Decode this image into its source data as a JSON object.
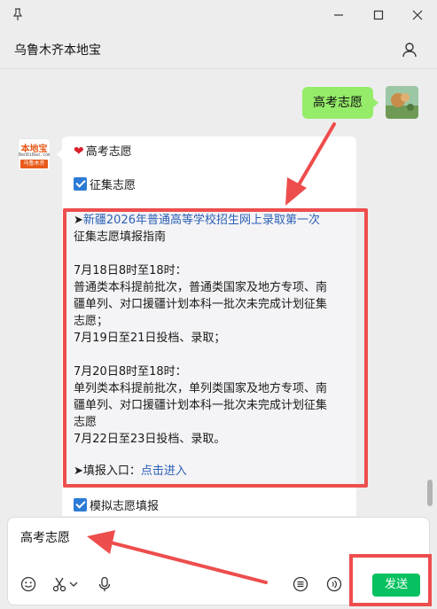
{
  "window": {
    "pin_icon": "pin-icon",
    "minimize_icon": "minimize-icon",
    "maximize_icon": "maximize-icon",
    "close_icon": "close-icon"
  },
  "header": {
    "title": "乌鲁木齐本地宝",
    "profile_icon": "user-icon"
  },
  "chat": {
    "sent_message": "高考志愿",
    "bot_avatar": {
      "logo_text": "本地宝",
      "site_text": "BenDiBao.com",
      "city_text": "乌鲁木齐"
    },
    "reply": {
      "title": "高考志愿",
      "item1": "征集志愿",
      "guide_title_line1": "新疆2026年普通高等学校招生网上录取第一次",
      "guide_title_line2": "征集志愿填报指南",
      "p1_head": "7月18日8时至18时：",
      "p1_l1": "普通类本科提前批次，普通类国家及地方专项、南",
      "p1_l2": "疆单列、对口援疆计划本科一批次未完成计划征集",
      "p1_l3": "志愿；",
      "p1_l4": "7月19日至21日投档、录取；",
      "p2_head": "7月20日8时至18时：",
      "p2_l1": "单列类本科提前批次，单列类国家及地方专项、南",
      "p2_l2": "疆单列、对口援疆计划本科一批次未完成计划征集",
      "p2_l3": "志愿",
      "p2_l4": "7月22日至23日投档、录取。",
      "entry_label": "填报入口：",
      "entry_link": "点击进入",
      "item2": "模拟志愿填报"
    }
  },
  "composer": {
    "input_value": "高考志愿",
    "send_label": "发送",
    "tools": [
      "emoji-icon",
      "scissors-icon",
      "chevron-down-icon",
      "microphone-icon",
      "list-icon",
      "voice-call-icon"
    ]
  },
  "colors": {
    "accent_green": "#07c160",
    "sent_bubble": "#95ec69",
    "annotation_red": "#ee4d4d",
    "link_blue": "#2a5fb5"
  }
}
